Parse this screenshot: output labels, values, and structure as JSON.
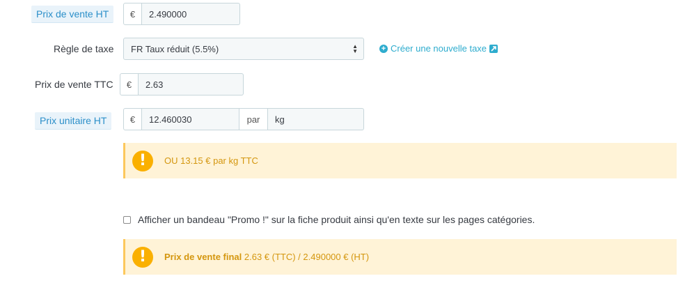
{
  "pricing": {
    "price_ht": {
      "label": "Prix de vente HT",
      "currency": "€",
      "value": "2.490000"
    },
    "tax_rule": {
      "label": "Règle de taxe",
      "selected": "FR Taux réduit (5.5%)",
      "create_link": "Créer une nouvelle taxe"
    },
    "price_ttc": {
      "label": "Prix de vente TTC",
      "currency": "€",
      "value": "2.63"
    },
    "unit_price": {
      "label": "Prix unitaire HT",
      "currency": "€",
      "value": "12.460030",
      "per_label": "par",
      "unit": "kg"
    }
  },
  "unit_price_alert": {
    "icon": "exclamation-icon",
    "text": "OU 13.15 € par kg TTC"
  },
  "promo_checkbox": {
    "checked": false,
    "label": "Afficher un bandeau \"Promo !\" sur la fiche produit ainsi qu'en texte sur les pages catégories."
  },
  "final_price_alert": {
    "icon": "exclamation-icon",
    "title": "Prix de vente final",
    "text": "2.63 € (TTC) / 2.490000 € (HT)"
  },
  "colors": {
    "accent": "#2eacce",
    "label_highlight_bg": "#e9f3fa",
    "label_highlight_text": "#2b8fc9",
    "warning_bg": "#fff3d7",
    "warning_icon": "#fab000",
    "warning_text": "#d4960e"
  }
}
